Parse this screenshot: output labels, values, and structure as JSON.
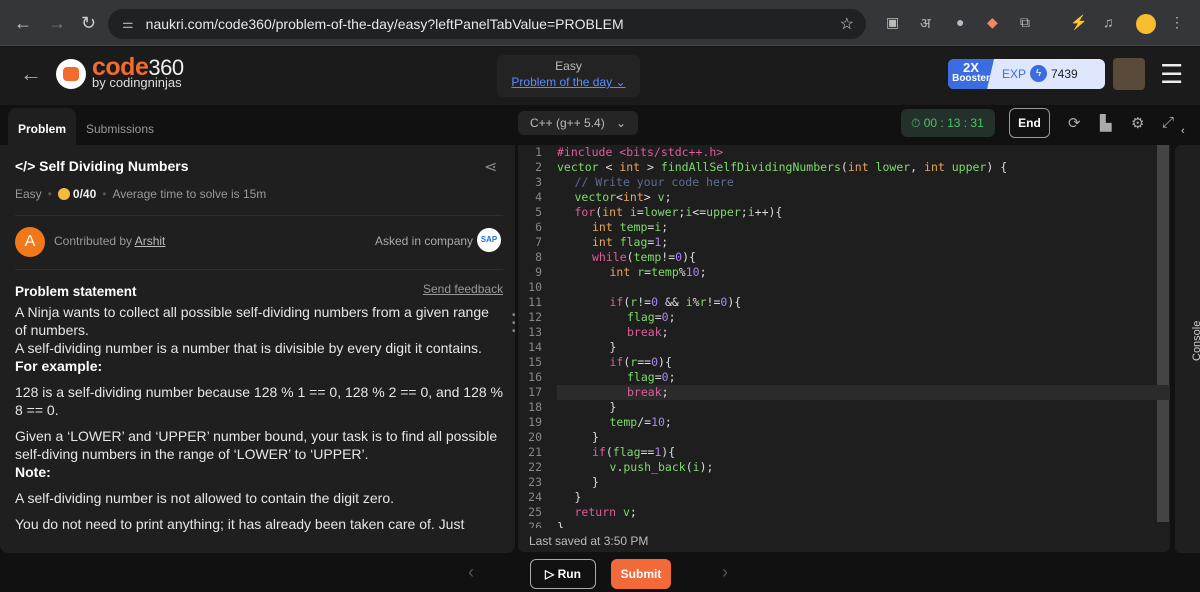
{
  "browser": {
    "url": "naukri.com/code360/problem-of-the-day/easy?leftPanelTabValue=PROBLEM",
    "ext_hindi": "अ"
  },
  "header": {
    "logo": "code",
    "logo_num": "360",
    "logo_sub": "by codingninjas",
    "difficulty": "Easy",
    "potd": "Problem of the day",
    "booster_x": "2X",
    "booster": "Booster",
    "exp_label": "EXP",
    "exp": "7439"
  },
  "tabs": [
    {
      "label": "Problem"
    },
    {
      "label": "Submissions"
    }
  ],
  "problem": {
    "title": "Self Dividing Numbers",
    "difficulty": "Easy",
    "score": "0/40",
    "avg_time": "Average time to solve is 15m",
    "author_initial": "A",
    "contributed_by": "Contributed by",
    "author": "Arshit",
    "asked": "Asked in company",
    "company": "SAP",
    "statement_label": "Problem statement",
    "feedback": "Send feedback",
    "p1": "A Ninja wants to collect all possible self-dividing numbers from a given range of numbers.",
    "p2": "A self-dividing number is a number that is divisible by every digit it contains.",
    "example_label": "For example:",
    "p3": "128 is a self-dividing number because 128 % 1 == 0, 128 % 2 == 0, and 128 % 8 == 0.",
    "p4": "Given a ‘LOWER’ and ‘UPPER’ number bound, your task is to find all possible self-diving numbers in the range of ‘LOWER’ to ‘UPPER’.",
    "note_label": "Note:",
    "p5": "A self-dividing number is not allowed to contain the digit zero.",
    "p6": "You do not need to print anything; it has already been taken care of. Just"
  },
  "editor": {
    "language": "C++ (g++ 5.4)",
    "timer": "00 : 13 : 31",
    "end": "End",
    "saved": "Last saved at 3:50 PM",
    "console": "Console",
    "run": "Run",
    "submit": "Submit",
    "highlight_line": 17,
    "lines": [
      [
        0,
        [
          [
            "pp",
            "#include <bits/stdc++.h>"
          ]
        ]
      ],
      [
        0,
        [
          [
            "id",
            "vector"
          ],
          [
            "pu",
            " < "
          ],
          [
            "ty",
            "int"
          ],
          [
            "pu",
            " > "
          ],
          [
            "id",
            "findAllSelfDividingNumbers"
          ],
          [
            "pu",
            "("
          ],
          [
            "ty",
            "int"
          ],
          [
            "id",
            " lower"
          ],
          [
            "pu",
            ", "
          ],
          [
            "ty",
            "int"
          ],
          [
            "id",
            " upper"
          ],
          [
            "pu",
            ") {"
          ]
        ]
      ],
      [
        1,
        [
          [
            "cm",
            "// Write your code here"
          ]
        ]
      ],
      [
        1,
        [
          [
            "id",
            "vector"
          ],
          [
            "pu",
            "<"
          ],
          [
            "ty",
            "int"
          ],
          [
            "pu",
            "> "
          ],
          [
            "id",
            "v"
          ],
          [
            "pu",
            ";"
          ]
        ]
      ],
      [
        1,
        [
          [
            "kw",
            "for"
          ],
          [
            "pu",
            "("
          ],
          [
            "ty",
            "int"
          ],
          [
            "id",
            " i"
          ],
          [
            "pu",
            "="
          ],
          [
            "id",
            "lower"
          ],
          [
            "pu",
            ";"
          ],
          [
            "id",
            "i"
          ],
          [
            "pu",
            "<="
          ],
          [
            "id",
            "upper"
          ],
          [
            "pu",
            ";"
          ],
          [
            "id",
            "i"
          ],
          [
            "pu",
            "++){"
          ]
        ]
      ],
      [
        2,
        [
          [
            "ty",
            "int"
          ],
          [
            "id",
            " temp"
          ],
          [
            "pu",
            "="
          ],
          [
            "id",
            "i"
          ],
          [
            "pu",
            ";"
          ]
        ]
      ],
      [
        2,
        [
          [
            "ty",
            "int"
          ],
          [
            "id",
            " flag"
          ],
          [
            "pu",
            "="
          ],
          [
            "nu",
            "1"
          ],
          [
            "pu",
            ";"
          ]
        ]
      ],
      [
        2,
        [
          [
            "kw",
            "while"
          ],
          [
            "pu",
            "("
          ],
          [
            "id",
            "temp"
          ],
          [
            "pu",
            "!="
          ],
          [
            "nu",
            "0"
          ],
          [
            "pu",
            "){"
          ]
        ]
      ],
      [
        3,
        [
          [
            "ty",
            "int"
          ],
          [
            "id",
            " r"
          ],
          [
            "pu",
            "="
          ],
          [
            "id",
            "temp"
          ],
          [
            "pu",
            "%"
          ],
          [
            "nu",
            "10"
          ],
          [
            "pu",
            ";"
          ]
        ]
      ],
      [
        0,
        []
      ],
      [
        3,
        [
          [
            "kw",
            "if"
          ],
          [
            "pu",
            "("
          ],
          [
            "id",
            "r"
          ],
          [
            "pu",
            "!="
          ],
          [
            "nu",
            "0"
          ],
          [
            "pu",
            " && "
          ],
          [
            "id",
            "i"
          ],
          [
            "pu",
            "%"
          ],
          [
            "id",
            "r"
          ],
          [
            "pu",
            "!="
          ],
          [
            "nu",
            "0"
          ],
          [
            "pu",
            "){"
          ]
        ]
      ],
      [
        4,
        [
          [
            "id",
            "flag"
          ],
          [
            "pu",
            "="
          ],
          [
            "nu",
            "0"
          ],
          [
            "pu",
            ";"
          ]
        ]
      ],
      [
        4,
        [
          [
            "kw",
            "break"
          ],
          [
            "pu",
            ";"
          ]
        ]
      ],
      [
        3,
        [
          [
            "pu",
            "}"
          ]
        ]
      ],
      [
        3,
        [
          [
            "kw",
            "if"
          ],
          [
            "pu",
            "("
          ],
          [
            "id",
            "r"
          ],
          [
            "pu",
            "=="
          ],
          [
            "nu",
            "0"
          ],
          [
            "pu",
            "){"
          ]
        ]
      ],
      [
        4,
        [
          [
            "id",
            "flag"
          ],
          [
            "pu",
            "="
          ],
          [
            "nu",
            "0"
          ],
          [
            "pu",
            ";"
          ]
        ]
      ],
      [
        4,
        [
          [
            "kw",
            "break"
          ],
          [
            "pu",
            ";"
          ]
        ]
      ],
      [
        3,
        [
          [
            "pu",
            "}"
          ]
        ]
      ],
      [
        3,
        [
          [
            "id",
            "temp"
          ],
          [
            "pu",
            "/="
          ],
          [
            "nu",
            "10"
          ],
          [
            "pu",
            ";"
          ]
        ]
      ],
      [
        2,
        [
          [
            "pu",
            "}"
          ]
        ]
      ],
      [
        2,
        [
          [
            "kw",
            "if"
          ],
          [
            "pu",
            "("
          ],
          [
            "id",
            "flag"
          ],
          [
            "pu",
            "=="
          ],
          [
            "nu",
            "1"
          ],
          [
            "pu",
            "){"
          ]
        ]
      ],
      [
        3,
        [
          [
            "id",
            "v"
          ],
          [
            "pu",
            "."
          ],
          [
            "id",
            "push_back"
          ],
          [
            "pu",
            "("
          ],
          [
            "id",
            "i"
          ],
          [
            "pu",
            ");"
          ]
        ]
      ],
      [
        2,
        [
          [
            "pu",
            "}"
          ]
        ]
      ],
      [
        1,
        [
          [
            "pu",
            "}"
          ]
        ]
      ],
      [
        1,
        [
          [
            "kw",
            "return"
          ],
          [
            "id",
            " v"
          ],
          [
            "pu",
            ";"
          ]
        ]
      ],
      [
        0,
        [
          [
            "pu",
            "}"
          ]
        ]
      ]
    ]
  }
}
